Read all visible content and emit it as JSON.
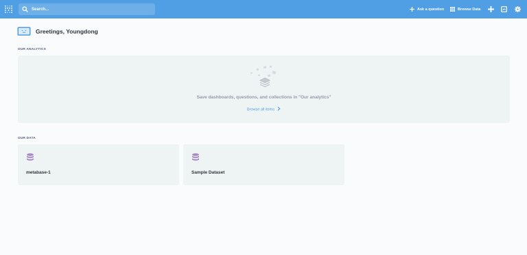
{
  "header": {
    "search_placeholder": "Search...",
    "ask_question_label": "Ask a question",
    "browse_data_label": "Browse Data",
    "icons": [
      "metabase-logo-icon",
      "search-icon",
      "ask-question-icon",
      "browse-data-icon",
      "plus-icon",
      "dashboard-icon",
      "gear-icon"
    ]
  },
  "greeting": {
    "text": "Greetings, Youngdong"
  },
  "analytics": {
    "section_label": "OUR ANALYTICS",
    "empty_message": "Save dashboards, questions, and collections in \"Our analytics\"",
    "browse_label": "Browse all items"
  },
  "data": {
    "section_label": "OUR DATA",
    "databases": [
      {
        "name": "metabase-1"
      },
      {
        "name": "Sample Dataset"
      }
    ]
  },
  "colors": {
    "brand": "#509ee3",
    "panel": "#eef3f3",
    "database_icon": "#a989c5"
  }
}
